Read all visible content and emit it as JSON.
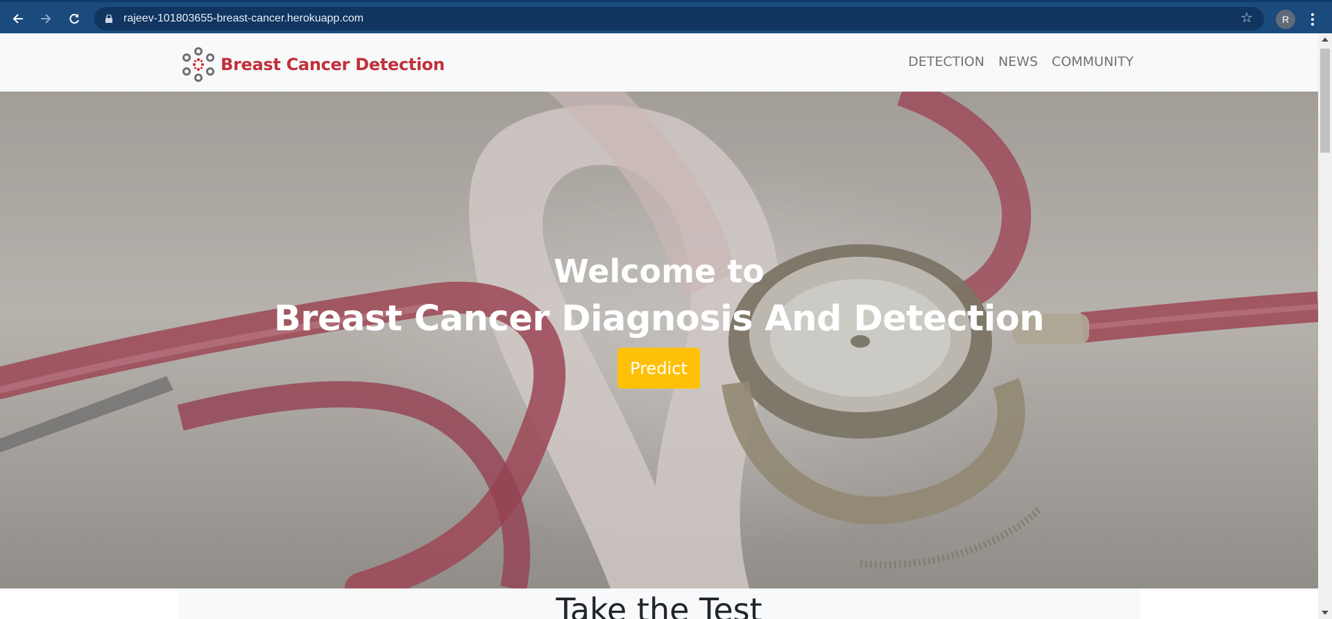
{
  "browser": {
    "url": "rajeev-101803655-breast-cancer.herokuapp.com",
    "profile_initial": "R",
    "icons": [
      "back-arrow-icon",
      "forward-arrow-icon",
      "reload-icon",
      "lock-icon",
      "star-icon",
      "menu-dots-icon"
    ]
  },
  "navbar": {
    "brand": "Breast Cancer Detection",
    "links": [
      "DETECTION",
      "NEWS",
      "COMMUNITY"
    ],
    "brand_color": "#c0313a"
  },
  "hero": {
    "subtitle": "Welcome to",
    "title": "Breast Cancer Diagnosis And Detection",
    "button": "Predict",
    "button_color": "#ffc107"
  },
  "section": {
    "title": "Take the Test"
  }
}
